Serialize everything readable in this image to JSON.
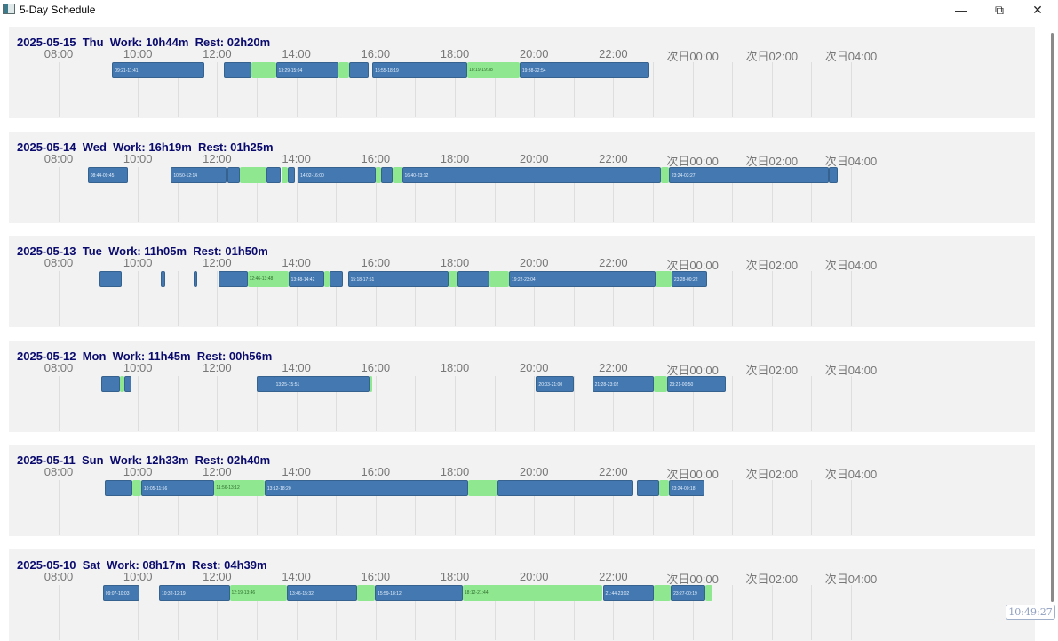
{
  "window": {
    "title": "5-Day Schedule",
    "icon": "schedule-app-icon",
    "controls": [
      "minimize-icon",
      "restore-icon",
      "close-icon"
    ]
  },
  "axis": {
    "ticks": [
      "08:00",
      "10:00",
      "12:00",
      "14:00",
      "16:00",
      "18:00",
      "20:00",
      "22:00",
      "次日00:00",
      "次日02:00",
      "次日04:00"
    ]
  },
  "colors": {
    "work": "#4379b0",
    "rest": "#8fe88f",
    "header": "#0a0a6e"
  },
  "clock": "10:49:27",
  "days": [
    {
      "date": "2025-05-15",
      "weekday": "Thu",
      "work": "10h44m",
      "rest": "02h20m",
      "segments": [
        {
          "type": "work",
          "start": "09:21",
          "end": "11:41",
          "label": "09:21-11:41"
        },
        {
          "type": "work",
          "start": "12:10",
          "end": "12:52",
          "label": ""
        },
        {
          "type": "rest",
          "start": "12:52",
          "end": "13:29",
          "label": ""
        },
        {
          "type": "work",
          "start": "13:29",
          "end": "15:04",
          "label": "13:29-15:04"
        },
        {
          "type": "rest",
          "start": "15:04",
          "end": "15:20",
          "label": ""
        },
        {
          "type": "work",
          "start": "15:20",
          "end": "15:50",
          "label": ""
        },
        {
          "type": "work",
          "start": "15:55",
          "end": "18:19",
          "label": "15:55-18:19"
        },
        {
          "type": "rest",
          "start": "18:19",
          "end": "19:38",
          "label": "18:19-19:38"
        },
        {
          "type": "work",
          "start": "19:38",
          "end": "22:54",
          "label": "19:38-22:54"
        }
      ]
    },
    {
      "date": "2025-05-14",
      "weekday": "Wed",
      "work": "16h19m",
      "rest": "01h25m",
      "segments": [
        {
          "type": "work",
          "start": "08:44",
          "end": "09:45",
          "label": "08:44-09:45"
        },
        {
          "type": "work",
          "start": "10:50",
          "end": "12:14",
          "label": "10:50-12:14"
        },
        {
          "type": "work",
          "start": "12:16",
          "end": "12:35",
          "label": ""
        },
        {
          "type": "rest",
          "start": "12:35",
          "end": "13:15",
          "label": ""
        },
        {
          "type": "work",
          "start": "13:15",
          "end": "13:37",
          "label": ""
        },
        {
          "type": "rest",
          "start": "13:37",
          "end": "13:47",
          "label": ""
        },
        {
          "type": "work",
          "start": "13:47",
          "end": "13:58",
          "label": ""
        },
        {
          "type": "work",
          "start": "14:02",
          "end": "16:00",
          "label": "14:02-16:00"
        },
        {
          "type": "rest",
          "start": "16:00",
          "end": "16:08",
          "label": ""
        },
        {
          "type": "work",
          "start": "16:08",
          "end": "16:26",
          "label": ""
        },
        {
          "type": "rest",
          "start": "16:26",
          "end": "16:40",
          "label": ""
        },
        {
          "type": "work",
          "start": "16:40",
          "end": "23:12",
          "label": "16:40-23:12"
        },
        {
          "type": "rest",
          "start": "23:12",
          "end": "23:24",
          "label": ""
        },
        {
          "type": "work",
          "start": "23:24",
          "end": "03:27",
          "label": "23:24-03:27"
        },
        {
          "type": "work",
          "start": "03:27",
          "end": "03:40",
          "label": ""
        }
      ]
    },
    {
      "date": "2025-05-13",
      "weekday": "Tue",
      "work": "11h05m",
      "rest": "01h50m",
      "segments": [
        {
          "type": "work",
          "start": "09:02",
          "end": "09:35",
          "label": ""
        },
        {
          "type": "work",
          "start": "10:35",
          "end": "10:41",
          "label": ""
        },
        {
          "type": "work",
          "start": "11:25",
          "end": "11:29",
          "label": ""
        },
        {
          "type": "work",
          "start": "12:02",
          "end": "12:46",
          "label": ""
        },
        {
          "type": "rest",
          "start": "12:46",
          "end": "13:48",
          "label": "12:46-13:48"
        },
        {
          "type": "work",
          "start": "13:48",
          "end": "14:42",
          "label": "13:48-14:42"
        },
        {
          "type": "rest",
          "start": "14:42",
          "end": "14:50",
          "label": ""
        },
        {
          "type": "work",
          "start": "14:50",
          "end": "15:10",
          "label": ""
        },
        {
          "type": "work",
          "start": "15:18",
          "end": "17:51",
          "label": "15:18-17:51"
        },
        {
          "type": "rest",
          "start": "17:51",
          "end": "18:04",
          "label": ""
        },
        {
          "type": "work",
          "start": "18:04",
          "end": "18:53",
          "label": ""
        },
        {
          "type": "rest",
          "start": "18:53",
          "end": "19:22",
          "label": ""
        },
        {
          "type": "work",
          "start": "19:22",
          "end": "23:04",
          "label": "19:22-23:04"
        },
        {
          "type": "rest",
          "start": "23:04",
          "end": "23:28",
          "label": ""
        },
        {
          "type": "work",
          "start": "23:28",
          "end": "00:22",
          "label": "23:28-00:22"
        }
      ]
    },
    {
      "date": "2025-05-12",
      "weekday": "Mon",
      "work": "11h45m",
      "rest": "00h56m",
      "segments": [
        {
          "type": "work",
          "start": "09:04",
          "end": "09:33",
          "label": ""
        },
        {
          "type": "rest",
          "start": "09:33",
          "end": "09:39",
          "label": ""
        },
        {
          "type": "work",
          "start": "09:39",
          "end": "09:51",
          "label": ""
        },
        {
          "type": "work",
          "start": "13:00",
          "end": "13:30",
          "label": ""
        },
        {
          "type": "work",
          "start": "13:25",
          "end": "15:51",
          "label": "13:25-15:51"
        },
        {
          "type": "rest",
          "start": "15:51",
          "end": "15:54",
          "label": ""
        },
        {
          "type": "work",
          "start": "20:03",
          "end": "21:00",
          "label": "20:03-21:00"
        },
        {
          "type": "work",
          "start": "21:28",
          "end": "23:02",
          "label": "21:28-23:02"
        },
        {
          "type": "rest",
          "start": "23:02",
          "end": "23:21",
          "label": ""
        },
        {
          "type": "work",
          "start": "23:21",
          "end": "00:50",
          "label": "23:21-00:50"
        }
      ]
    },
    {
      "date": "2025-05-11",
      "weekday": "Sun",
      "work": "12h33m",
      "rest": "02h40m",
      "segments": [
        {
          "type": "work",
          "start": "09:10",
          "end": "09:52",
          "label": ""
        },
        {
          "type": "rest",
          "start": "09:52",
          "end": "10:05",
          "label": ""
        },
        {
          "type": "work",
          "start": "10:05",
          "end": "11:56",
          "label": "10:05-11:56"
        },
        {
          "type": "rest",
          "start": "11:56",
          "end": "13:12",
          "label": "11:56-13:12"
        },
        {
          "type": "work",
          "start": "13:12",
          "end": "18:20",
          "label": "13:12-18:20"
        },
        {
          "type": "rest",
          "start": "18:20",
          "end": "19:04",
          "label": ""
        },
        {
          "type": "work",
          "start": "19:04",
          "end": "22:31",
          "label": ""
        },
        {
          "type": "work",
          "start": "22:36",
          "end": "23:09",
          "label": ""
        },
        {
          "type": "rest",
          "start": "23:09",
          "end": "23:24",
          "label": ""
        },
        {
          "type": "work",
          "start": "23:24",
          "end": "00:18",
          "label": "23:24-00:18"
        }
      ]
    },
    {
      "date": "2025-05-10",
      "weekday": "Sat",
      "work": "08h17m",
      "rest": "04h39m",
      "segments": [
        {
          "type": "work",
          "start": "09:07",
          "end": "10:03",
          "label": "09:07-10:03"
        },
        {
          "type": "work",
          "start": "10:32",
          "end": "12:19",
          "label": "10:32-12:19"
        },
        {
          "type": "rest",
          "start": "12:19",
          "end": "13:46",
          "label": "12:19-13:46"
        },
        {
          "type": "work",
          "start": "13:46",
          "end": "15:32",
          "label": "13:46-15:32"
        },
        {
          "type": "rest",
          "start": "15:32",
          "end": "15:59",
          "label": ""
        },
        {
          "type": "work",
          "start": "15:59",
          "end": "18:12",
          "label": "15:59-18:12"
        },
        {
          "type": "rest",
          "start": "18:12",
          "end": "21:44",
          "label": "18:12-21:44"
        },
        {
          "type": "work",
          "start": "21:44",
          "end": "23:02",
          "label": "21:44-23:02"
        },
        {
          "type": "rest",
          "start": "23:02",
          "end": "23:27",
          "label": ""
        },
        {
          "type": "work",
          "start": "23:27",
          "end": "00:19",
          "label": "23:27-00:19"
        },
        {
          "type": "rest",
          "start": "00:19",
          "end": "00:30",
          "label": ""
        }
      ]
    }
  ]
}
